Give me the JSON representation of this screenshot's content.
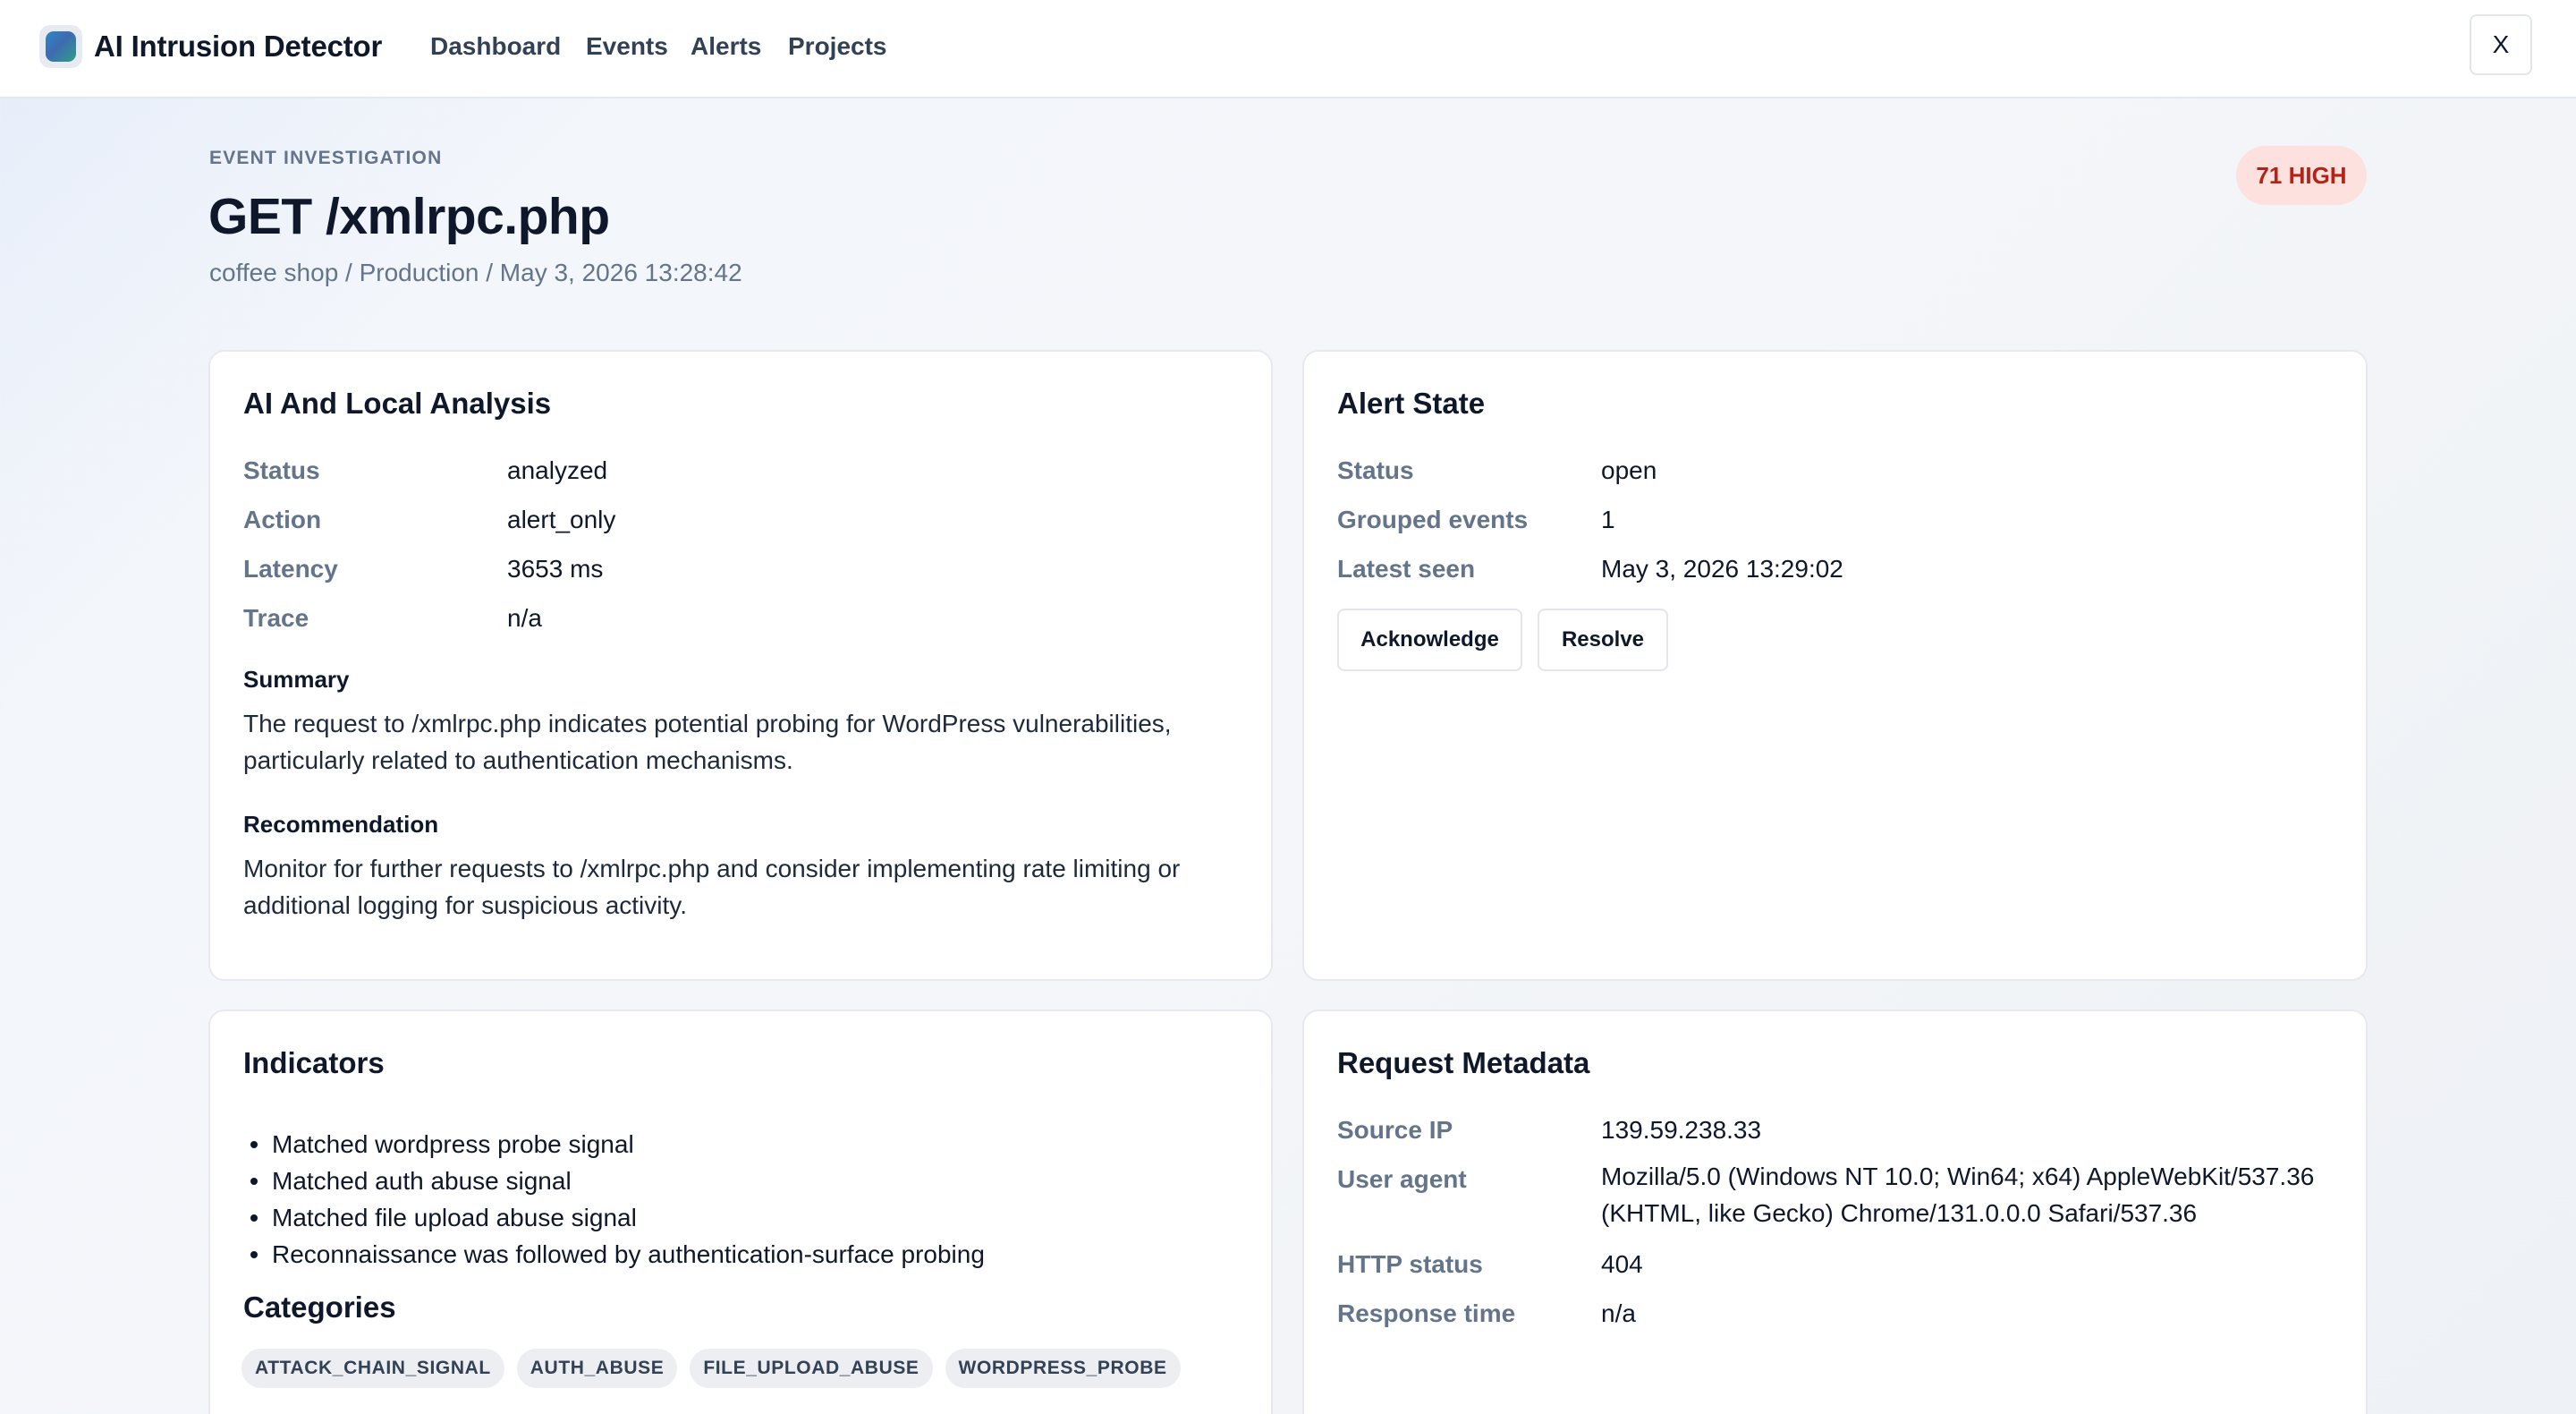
{
  "app": {
    "name": "AI Intrusion Detector",
    "nav": [
      "Dashboard",
      "Events",
      "Alerts",
      "Projects"
    ],
    "close_label": "X"
  },
  "header": {
    "eyebrow": "EVENT INVESTIGATION",
    "title": "GET /xmlrpc.php",
    "subtitle": "coffee shop / Production / May 3, 2026 13:28:42",
    "severity": "71 HIGH"
  },
  "analysis": {
    "title": "AI And Local Analysis",
    "fields": [
      {
        "label": "Status",
        "value": "analyzed"
      },
      {
        "label": "Action",
        "value": "alert_only"
      },
      {
        "label": "Latency",
        "value": "3653 ms"
      },
      {
        "label": "Trace",
        "value": "n/a"
      }
    ],
    "summary_label": "Summary",
    "summary": "The request to /xmlrpc.php indicates potential probing for WordPress vulnerabilities, particularly related to authentication mechanisms.",
    "recommendation_label": "Recommendation",
    "recommendation": "Monitor for further requests to /xmlrpc.php and consider implementing rate limiting or additional logging for suspicious activity."
  },
  "alert_state": {
    "title": "Alert State",
    "fields": [
      {
        "label": "Status",
        "value": "open"
      },
      {
        "label": "Grouped events",
        "value": "1"
      },
      {
        "label": "Latest seen",
        "value": "May 3, 2026 13:29:02"
      }
    ],
    "acknowledge_label": "Acknowledge",
    "resolve_label": "Resolve"
  },
  "indicators": {
    "title": "Indicators",
    "items": [
      "Matched wordpress probe signal",
      "Matched auth abuse signal",
      "Matched file upload abuse signal",
      "Reconnaissance was followed by authentication-surface probing"
    ],
    "categories_title": "Categories",
    "categories": [
      "ATTACK_CHAIN_SIGNAL",
      "AUTH_ABUSE",
      "FILE_UPLOAD_ABUSE",
      "WORDPRESS_PROBE"
    ]
  },
  "request_metadata": {
    "title": "Request Metadata",
    "fields": [
      {
        "label": "Source IP",
        "value": "139.59.238.33"
      },
      {
        "label": "User agent",
        "value": "Mozilla/5.0 (Windows NT 10.0; Win64; x64) AppleWebKit/537.36 (KHTML, like Gecko) Chrome/131.0.0.0 Safari/537.36"
      },
      {
        "label": "HTTP status",
        "value": "404"
      },
      {
        "label": "Response time",
        "value": "n/a"
      }
    ]
  },
  "colors": {
    "severity_high_bg": "#fde1df",
    "severity_high_text": "#b42318"
  }
}
